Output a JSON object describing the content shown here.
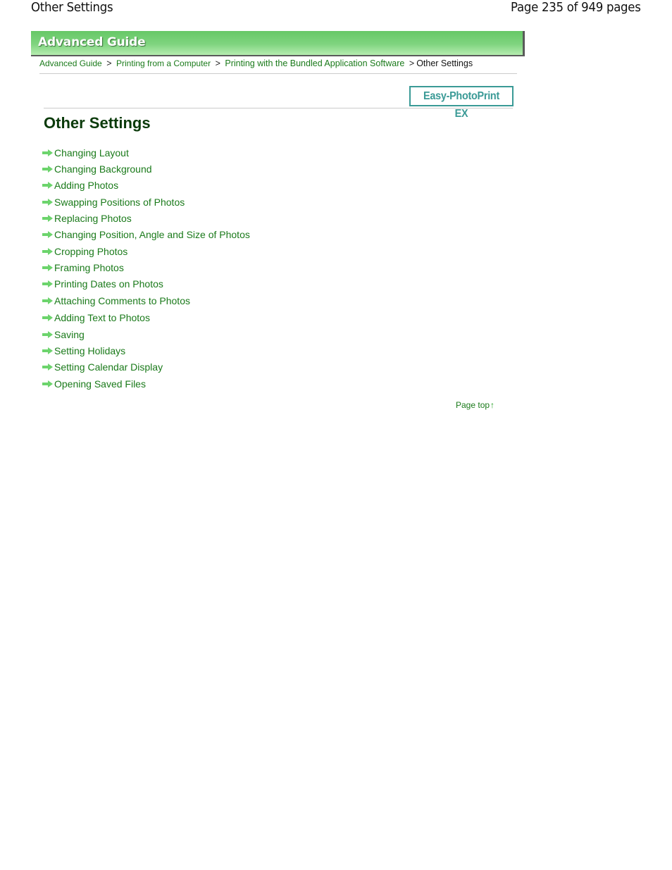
{
  "header": {
    "title": "Other Settings",
    "page_count": "Page 235 of 949 pages"
  },
  "banner": {
    "title": "Advanced Guide",
    "colors": {
      "gradient_top": "#66c866",
      "gradient_bottom": "#b6ecb0",
      "shadow": "#5a5a5a"
    }
  },
  "breadcrumb": {
    "items": [
      {
        "label": "Advanced Guide"
      },
      {
        "label": "Printing from a Computer"
      },
      {
        "label": "Printing with the Bundled Application Software"
      },
      {
        "label": "Other Settings"
      }
    ],
    "separator": ">"
  },
  "app_badge": {
    "label": "Easy-PhotoPrint EX",
    "color": "#3a9a96"
  },
  "main": {
    "title": "Other Settings",
    "links": [
      {
        "label": "Changing Layout",
        "icon": "right-arrow-icon"
      },
      {
        "label": "Changing Background",
        "icon": "right-arrow-icon"
      },
      {
        "label": "Adding Photos",
        "icon": "right-arrow-icon"
      },
      {
        "label": "Swapping Positions of Photos",
        "icon": "right-arrow-icon"
      },
      {
        "label": "Replacing Photos",
        "icon": "right-arrow-icon"
      },
      {
        "label": "Changing Position, Angle and Size of Photos",
        "icon": "right-arrow-icon"
      },
      {
        "label": "Cropping Photos",
        "icon": "right-arrow-icon"
      },
      {
        "label": "Framing Photos",
        "icon": "right-arrow-icon"
      },
      {
        "label": "Printing Dates on Photos",
        "icon": "right-arrow-icon"
      },
      {
        "label": "Attaching Comments to Photos",
        "icon": "right-arrow-icon"
      },
      {
        "label": "Adding Text to Photos",
        "icon": "right-arrow-icon"
      },
      {
        "label": "Saving",
        "icon": "right-arrow-icon"
      },
      {
        "label": "Setting Holidays",
        "icon": "right-arrow-icon"
      },
      {
        "label": "Setting Calendar Display",
        "icon": "right-arrow-icon"
      },
      {
        "label": "Opening Saved Files",
        "icon": "right-arrow-icon"
      }
    ],
    "link_color": "#1a7a1a",
    "arrow_color": "#6cd46c"
  },
  "footer": {
    "page_top_label": "Page top",
    "page_top_icon": "↑"
  }
}
